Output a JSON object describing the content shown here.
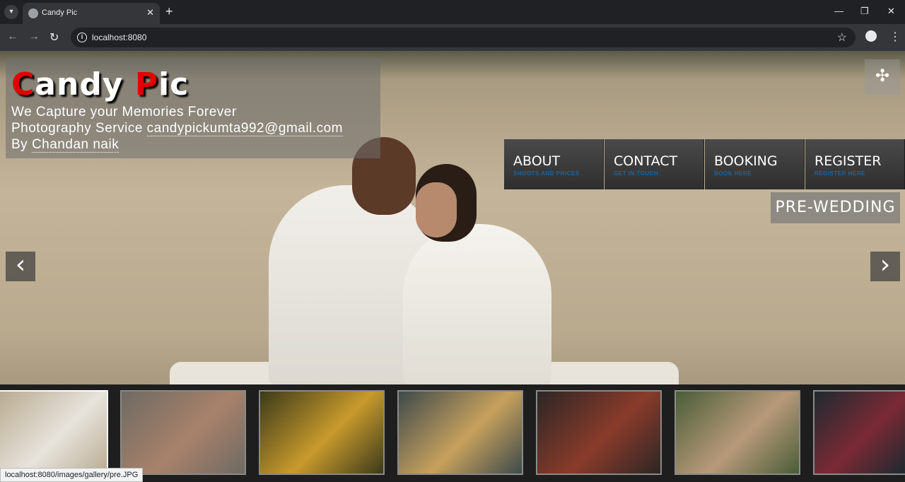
{
  "browser": {
    "tab_title": "Candy Pic",
    "tab_menu_icon": "chevron-down-icon",
    "close_glyph": "✕",
    "new_tab_glyph": "+",
    "url": "localhost:8080",
    "status_url": "localhost:8080/images/gallery/pre.JPG"
  },
  "brand": {
    "title_first_letter": "C",
    "title_first_rest": "andy ",
    "title_second_letter": "P",
    "title_second_rest": "ic",
    "tagline_1": "We Capture your Memories Forever",
    "tagline_2_prefix": "Photography Service ",
    "email": "candypickumta992@gmail.com",
    "tagline_3_prefix": "By ",
    "author": "Chandan naik",
    "accent_color": "#e30000"
  },
  "menu": [
    {
      "label": "ABOUT",
      "sub": "SHOOTS AND PRICES"
    },
    {
      "label": "CONTACT",
      "sub": "GET IN TOUCH"
    },
    {
      "label": "BOOKING",
      "sub": "BOOK HERE"
    },
    {
      "label": "REGISTER",
      "sub": "REGISTER HERE"
    }
  ],
  "slider": {
    "caption": "PRE-WEDDING",
    "prev_glyph": "‹",
    "next_glyph": "›",
    "fullscreen_icon": "collapse-icon"
  },
  "thumbnails": [
    {
      "name": "couple-beach",
      "colors": [
        "#b9ab92",
        "#e7e3db"
      ]
    },
    {
      "name": "couple-traditional",
      "colors": [
        "#6e6a63",
        "#a8826a"
      ]
    },
    {
      "name": "bride-yellow",
      "colors": [
        "#3b3a1a",
        "#c89a2c"
      ]
    },
    {
      "name": "girl-saree",
      "colors": [
        "#3d4a4c",
        "#c7a15c"
      ]
    },
    {
      "name": "child-krishna",
      "colors": [
        "#2c2625",
        "#8a3b2a"
      ]
    },
    {
      "name": "couple-garden",
      "colors": [
        "#4a5d38",
        "#b89a7a"
      ]
    },
    {
      "name": "couple-night",
      "colors": [
        "#1e2a30",
        "#7a2a35"
      ]
    }
  ]
}
